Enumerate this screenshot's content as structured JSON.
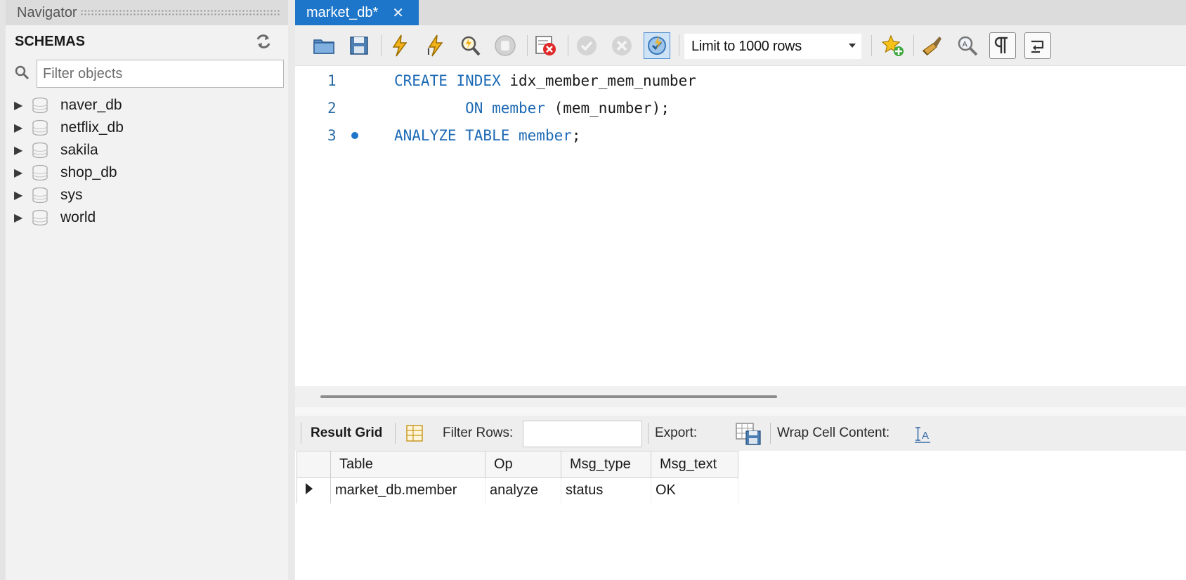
{
  "navigator": {
    "header_label": "Navigator",
    "schemas_title": "SCHEMAS",
    "filter_placeholder": "Filter objects",
    "schemas": [
      "naver_db",
      "netflix_db",
      "sakila",
      "shop_db",
      "sys",
      "world"
    ]
  },
  "tabs": [
    {
      "label": "market_db*",
      "active": true
    }
  ],
  "toolbar": {
    "icons": [
      "open-file-icon",
      "save-icon",
      "execute-icon",
      "execute-current-icon",
      "explain-icon",
      "stop-icon",
      "toggle-error-stop-icon",
      "commit-icon",
      "rollback-icon",
      "auto-commit-icon"
    ],
    "limit_rows": "Limit to 1000 rows",
    "right_icons": [
      "add-snippet-icon",
      "beautify-icon",
      "find-icon",
      "invisible-chars-icon",
      "wrap-lines-icon"
    ]
  },
  "editor": {
    "lines": [
      {
        "number": "1",
        "parts": [
          {
            "text": "CREATE INDEX",
            "kw": true
          },
          {
            "text": " idx_member_mem_number",
            "kw": false
          }
        ]
      },
      {
        "number": "2",
        "parts": [
          {
            "text": "        ON",
            "kw": true
          },
          {
            "text": " member",
            "kw": true
          },
          {
            "text": " (mem_number);",
            "kw": false
          }
        ]
      },
      {
        "number": "3",
        "marker": true,
        "parts": [
          {
            "text": "ANALYZE TABLE",
            "kw": true
          },
          {
            "text": " member",
            "kw": true
          },
          {
            "text": ";",
            "kw": false
          }
        ]
      }
    ]
  },
  "result": {
    "grid_label": "Result Grid",
    "filter_rows_label": "Filter Rows:",
    "filter_rows_value": "",
    "export_label": "Export:",
    "wrap_label": "Wrap Cell Content:",
    "columns": [
      "Table",
      "Op",
      "Msg_type",
      "Msg_text"
    ],
    "rows": [
      [
        "market_db.member",
        "analyze",
        "status",
        "OK"
      ]
    ]
  },
  "colors": {
    "accent": "#1d76c9",
    "keyword": "#1d6ab5"
  }
}
